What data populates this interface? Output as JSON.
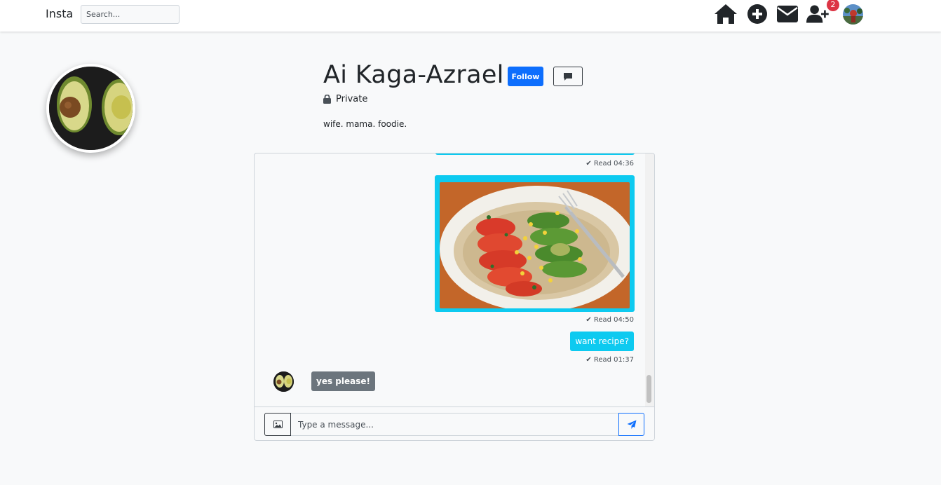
{
  "navbar": {
    "brand": "Insta",
    "search_placeholder": "Search...",
    "icons": [
      "home-icon",
      "plus-circle-icon",
      "envelope-icon",
      "user-plus-icon"
    ],
    "notification_count": "2"
  },
  "profile": {
    "name": "Ai Kaga-Azrael",
    "follow_label": "Follow",
    "privacy_label": "Private",
    "bio": "wife. mama. foodie."
  },
  "chat": {
    "messages": [
      {
        "type": "sent-image",
        "read_status": "✔ Read 04:36"
      },
      {
        "type": "sent-image",
        "read_status": "✔ Read 04:50"
      },
      {
        "type": "sent-text",
        "text": "want recipe?",
        "read_status": "✔ Read 01:37"
      },
      {
        "type": "received-text",
        "text": "yes please!"
      }
    ],
    "input_placeholder": "Type a message..."
  },
  "colors": {
    "primary": "#0d6efd",
    "sent_bubble": "#0dcaf0",
    "received_bubble": "#6c757d",
    "badge": "#dc3545"
  }
}
